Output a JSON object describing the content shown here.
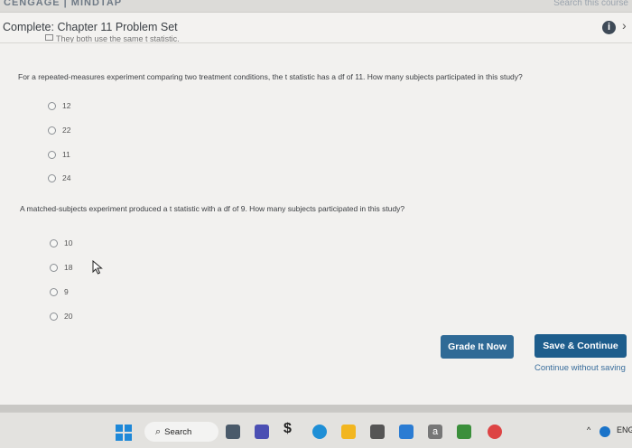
{
  "browser": {
    "brand_partial": "CENGAGE | MINDTAP",
    "search_partial": "Search this course"
  },
  "header": {
    "title": "Complete: Chapter 11 Problem Set",
    "prev_partial": "They both use the same t statistic."
  },
  "question1": {
    "text": "For a repeated-measures experiment comparing two treatment conditions, the t statistic has a df of 11. How many subjects participated in this study?",
    "options": [
      "12",
      "22",
      "11",
      "24"
    ]
  },
  "question2": {
    "text": "A matched-subjects experiment produced a t statistic with a df of 9. How many subjects participated in this study?",
    "options": [
      "10",
      "18",
      "9",
      "20"
    ]
  },
  "actions": {
    "grade_label": "Grade It Now",
    "save_label": "Save & Continue",
    "continue_label": "Continue without saving"
  },
  "taskbar": {
    "search_label": "Search",
    "tray_lang": "ENG"
  },
  "colors": {
    "button_grade": "#2f6a96",
    "button_save": "#1d5d8c",
    "link": "#3a6e9c",
    "win_logo": "#1e88d8"
  }
}
